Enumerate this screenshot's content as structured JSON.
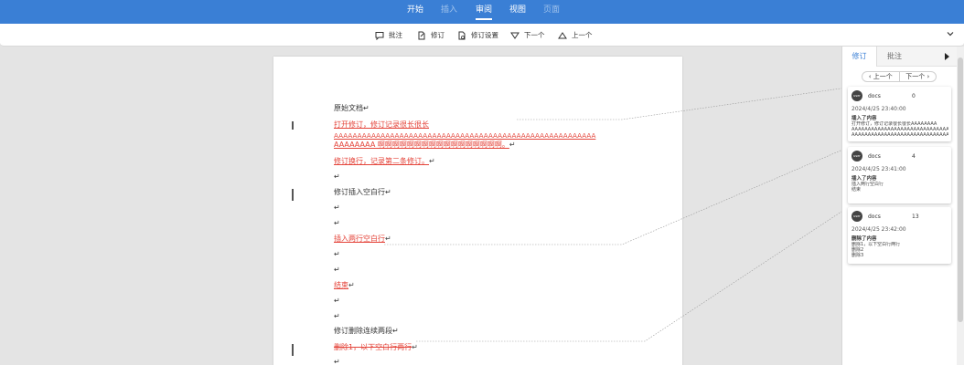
{
  "menu": {
    "items": [
      {
        "label": "开始",
        "state": "normal"
      },
      {
        "label": "插入",
        "state": "disabled"
      },
      {
        "label": "审阅",
        "state": "active"
      },
      {
        "label": "视图",
        "state": "normal"
      },
      {
        "label": "页面",
        "state": "disabled"
      }
    ]
  },
  "toolbar": {
    "comment_label": "批注",
    "revise_label": "修订",
    "revise_settings_label": "修订设置",
    "next_label": "下一个",
    "prev_label": "上一个"
  },
  "document": {
    "lines": [
      "原始文档↵",
      "打开修订，修订记录很长很长",
      "AAAAAAAAAAAAAAAAAAAAAAAAAAAAAAAAAAAAAAAAAAAAAAAAAAAAAAAA",
      "AAAAAAAA 啊啊啊啊啊啊啊啊啊啊啊啊啊啊啊啊啊。",
      "修订换行，记录第二条修订。",
      "↵",
      "修订插入空白行↵",
      "↵",
      "↵",
      "插入两行空白行",
      "↵",
      "↵",
      "结束",
      "↵",
      "↵",
      "修订删除连续两段↵",
      "删除1，以下空白行两行",
      "↵"
    ],
    "return_mark": "↵"
  },
  "panel": {
    "tab_revisions": "修订",
    "tab_comments": "批注",
    "prev_label": "上一个",
    "next_label": "下一个",
    "cards": [
      {
        "avatar": "user",
        "user": "docs",
        "number": "0",
        "time": "2024/4/25 23:40:00",
        "type": "插入了内容",
        "body": [
          "打开修订，修订记录很长很长AAAAAAAA",
          "AAAAAAAAAAAAAAAAAAAAAAAAAAAAAAAAAA",
          "AAAAAAAAAAAAAAAAAAAAAAAAAAAAAAAAAA"
        ]
      },
      {
        "avatar": "user",
        "user": "docs",
        "number": "4",
        "time": "2024/4/25 23:41:00",
        "type": "插入了内容",
        "body": [
          "插入两行空白行",
          "结束"
        ]
      },
      {
        "avatar": "user",
        "user": "docs",
        "number": "13",
        "time": "2024/4/25 23:42:00",
        "type": "删除了内容",
        "body": [
          "删除1，以下空白行两行",
          "删除2",
          "删除3"
        ]
      }
    ]
  },
  "colors": {
    "accent": "#3a7fd5",
    "revision": "#e4443a"
  }
}
